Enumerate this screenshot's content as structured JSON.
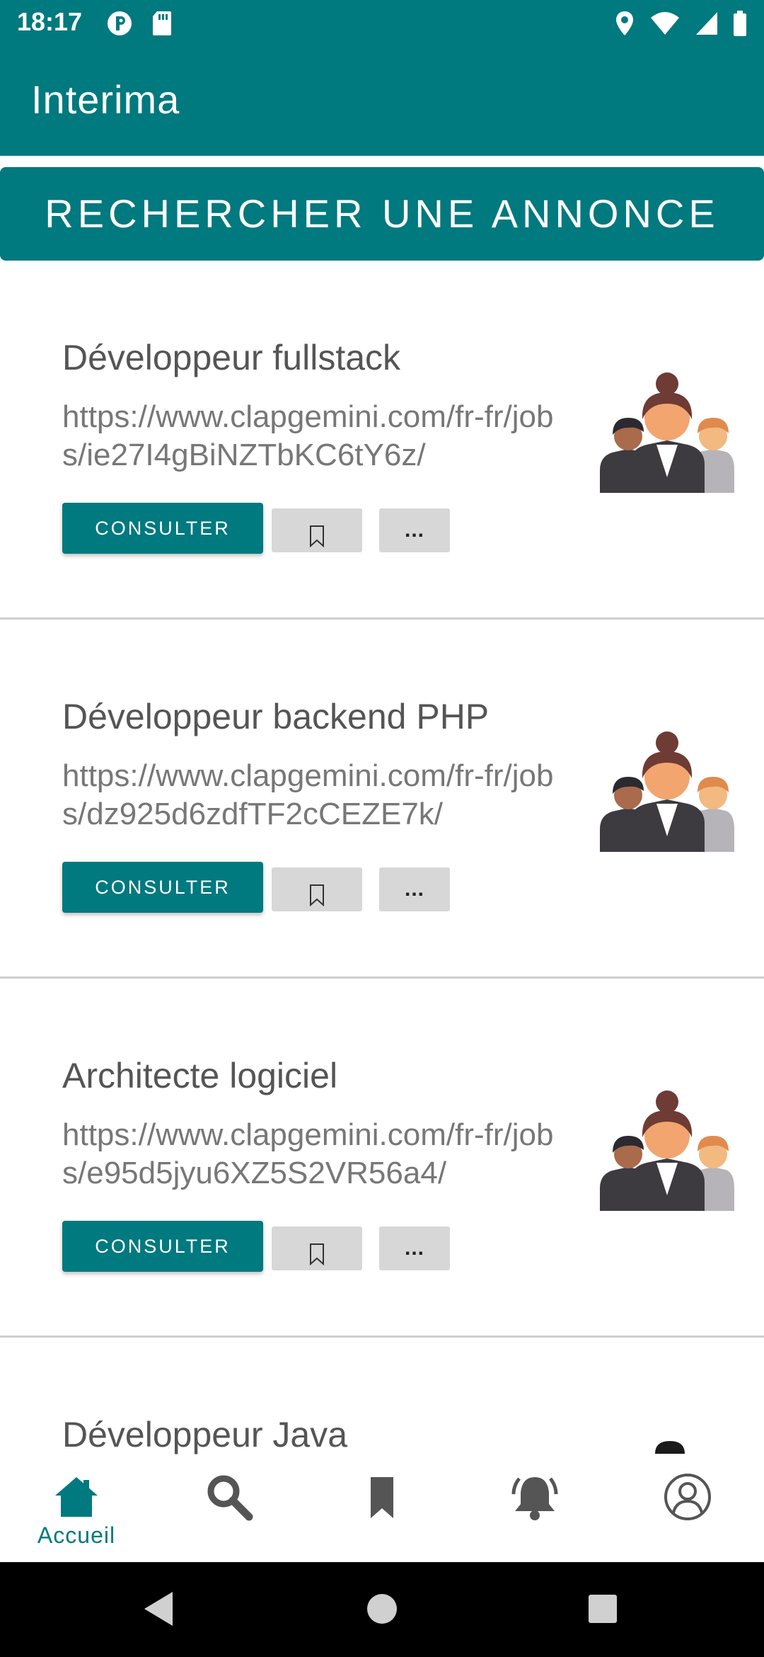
{
  "status_bar": {
    "time": "18:17",
    "left_icons": [
      "p-circle-icon",
      "sd-card-icon"
    ],
    "right_icons": [
      "location-icon",
      "wifi-icon",
      "signal-icon",
      "battery-icon"
    ]
  },
  "app_bar": {
    "title": "Interima"
  },
  "search_button": {
    "label": "RECHERCHER UNE ANNONCE"
  },
  "jobs": [
    {
      "title": "Développeur fullstack",
      "url": "https://www.clapgemini.com/fr-fr/jobs/ie27I4gBiNZTbKC6tY6z/",
      "consult_label": "CONSULTER",
      "more_label": "..."
    },
    {
      "title": "Développeur backend PHP",
      "url": "https://www.clapgemini.com/fr-fr/jobs/dz925d6zdfTF2cCEZE7k/",
      "consult_label": "CONSULTER",
      "more_label": "..."
    },
    {
      "title": "Architecte logiciel",
      "url": "https://www.clapgemini.com/fr-fr/jobs/e95d5jyu6XZ5S2VR56a4/",
      "consult_label": "CONSULTER",
      "more_label": "..."
    },
    {
      "title": "Développeur Java",
      "url": "",
      "consult_label": "",
      "more_label": ""
    }
  ],
  "bottom_nav": {
    "items": [
      {
        "label": "Accueil",
        "icon": "home-icon",
        "active": true
      },
      {
        "label": "",
        "icon": "search-icon",
        "active": false
      },
      {
        "label": "",
        "icon": "bookmark-icon",
        "active": false
      },
      {
        "label": "",
        "icon": "bell-icon",
        "active": false
      },
      {
        "label": "",
        "icon": "profile-icon",
        "active": false
      }
    ]
  },
  "colors": {
    "primary": "#00797f",
    "secondary_button": "#d7d7d7",
    "nav_inactive": "#555555"
  }
}
